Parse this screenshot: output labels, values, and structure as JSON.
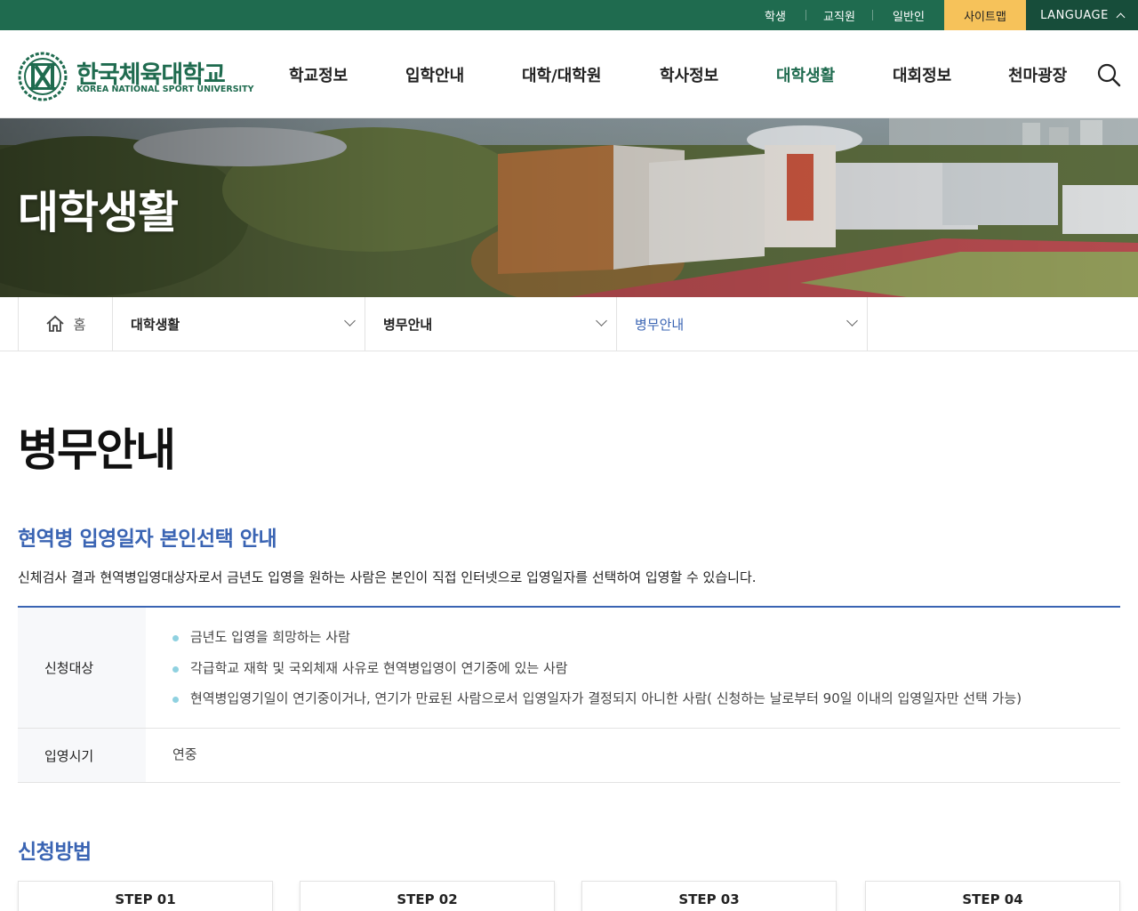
{
  "topbar": {
    "links": [
      "학생",
      "교직원",
      "일반인"
    ],
    "sitemap": "사이트맵",
    "language": "LANGUAGE"
  },
  "logo": {
    "name_ko": "한국체육대학교",
    "name_en": "KOREA NATIONAL SPORT UNIVERSITY"
  },
  "nav": {
    "items": [
      "학교정보",
      "입학안내",
      "대학/대학원",
      "학사정보",
      "대학생활",
      "대회정보",
      "천마광장"
    ],
    "active_index": 4
  },
  "banner": {
    "title": "대학생활"
  },
  "breadcrumb": {
    "home": "홈",
    "level1": "대학생활",
    "level2": "병무안내",
    "level3": "병무안내"
  },
  "page": {
    "title": "병무안내",
    "section1": {
      "title": "현역병 입영일자 본인선택 안내",
      "intro": "신체검사 결과 현역병입영대상자로서 금년도 입영을 원하는 사람은 본인이 직접 인터넷으로 입영일자를 선택하여 입영할 수 있습니다.",
      "rows": [
        {
          "label": "신청대상",
          "items": [
            "금년도 입영을 희망하는 사람",
            "각급학교 재학 및 국외체재 사유로 현역병입영이 연기중에 있는 사람",
            "현역병입영기일이 연기중이거나, 연기가 만료된 사람으로서 입영일자가 결정되지 아니한 사람( 신청하는 날로부터 90일 이내의 입영일자만 선택 가능)"
          ]
        },
        {
          "label": "입영시기",
          "value": "연중"
        }
      ]
    },
    "section2": {
      "title": "신청방법",
      "steps": [
        "STEP 01",
        "STEP 02",
        "STEP 03",
        "STEP 04"
      ]
    }
  },
  "colors": {
    "brand_green": "#1f6b4f",
    "sitemap_yellow": "#f6c25a",
    "accent_blue": "#3a64b3"
  }
}
